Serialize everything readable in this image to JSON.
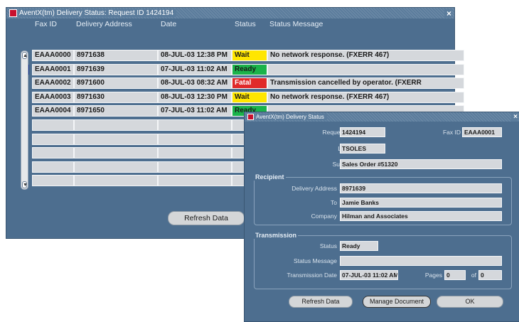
{
  "main_window": {
    "title": "AventX(tm) Delivery Status: Request ID 1424194",
    "close_label": "×",
    "columns": [
      "Fax ID",
      "Delivery Address",
      "Date",
      "Status",
      "Status Message"
    ],
    "rows": [
      {
        "fax_id": "EAAA0000",
        "address": "8971638",
        "date": "08-JUL-03 12:38 PM",
        "status": "Wait",
        "message": "No network response. (FXERR 467)"
      },
      {
        "fax_id": "EAAA0001",
        "address": "8971639",
        "date": "07-JUL-03 11:02 AM",
        "status": "Ready",
        "message": ""
      },
      {
        "fax_id": "EAAA0002",
        "address": "8971600",
        "date": "08-JUL-03 08:32 AM",
        "status": "Fatal",
        "message": "Transmission cancelled by operator. (FXERR"
      },
      {
        "fax_id": "EAAA0003",
        "address": "8971630",
        "date": "08-JUL-03 12:30 PM",
        "status": "Wait",
        "message": "No network response. (FXERR 467)"
      },
      {
        "fax_id": "EAAA0004",
        "address": "8971650",
        "date": "07-JUL-03 11:02 AM",
        "status": "Ready",
        "message": ""
      }
    ],
    "empty_rows": 5,
    "refresh_label": "Refresh Data"
  },
  "status_colors": {
    "Wait": "#ffe600",
    "Ready": "#1bb34a",
    "Fatal": "#e02a2a"
  },
  "dialog": {
    "title": "AventX(tm) Delivery Status",
    "close_label": "×",
    "request_id_label": "Request ID",
    "request_id": "1424194",
    "fax_id_label": "Fax ID",
    "fax_id": "EAAA0001",
    "login_label": "Login",
    "login": "TSOLES",
    "subject_label": "Subject",
    "subject": "Sales Order #51320",
    "recipient": {
      "group_label": "Recipient",
      "address_label": "Delivery Address",
      "address": "8971639",
      "to_label": "To",
      "to": "Jamie Banks",
      "company_label": "Company",
      "company": "Hilman and Associates"
    },
    "transmission": {
      "group_label": "Transmission",
      "status_label": "Status",
      "status": "Ready",
      "message_label": "Status Message",
      "message": "",
      "date_label": "Transmission Date",
      "date": "07-JUL-03 11:02 AM",
      "pages_label": "Pages",
      "pages": "0",
      "of_label": "of",
      "pages_total": "0"
    },
    "buttons": {
      "refresh": "Refresh Data",
      "manage": "Manage Document",
      "ok": "OK"
    }
  }
}
